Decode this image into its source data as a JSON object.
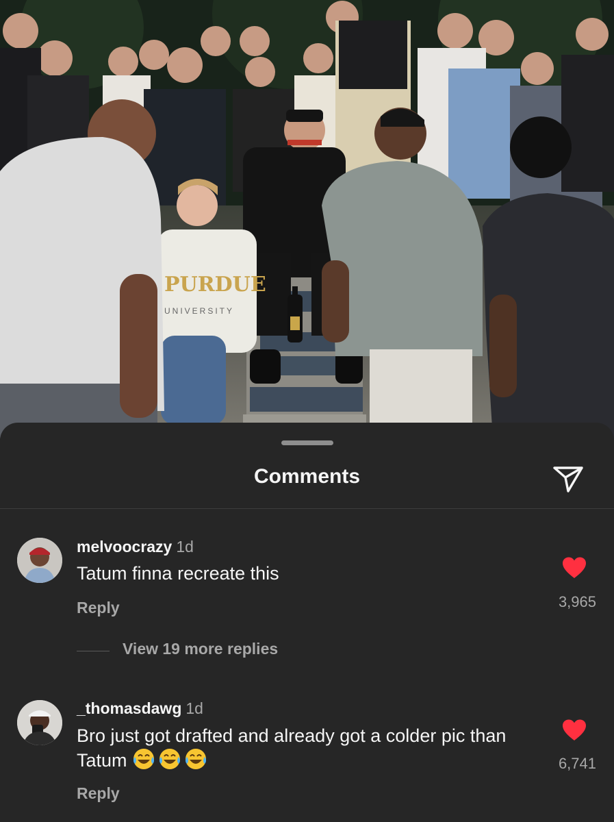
{
  "photo": {
    "shirt_text": "PURDUE",
    "shirt_subtext": "UNIVERSITY"
  },
  "comments_sheet": {
    "title": "Comments",
    "share_icon": "paper-plane-icon"
  },
  "comments": [
    {
      "username": "melvoocrazy",
      "time": "1d",
      "text": "Tatum finna recreate this",
      "reply_label": "Reply",
      "likes": "3,965",
      "liked": true,
      "view_replies": "View 19 more replies"
    },
    {
      "username": "_thomasdawg",
      "time": "1d",
      "text": "Bro just got drafted and already got a colder pic than Tatum",
      "emojis": [
        "laughing-tears-emoji",
        "laughing-tears-emoji",
        "laughing-tears-emoji"
      ],
      "reply_label": "Reply",
      "likes": "6,741",
      "liked": true
    }
  ],
  "colors": {
    "sheet_background": "#262626",
    "like_red": "#ff3040",
    "secondary_text": "#a8a8a8"
  }
}
